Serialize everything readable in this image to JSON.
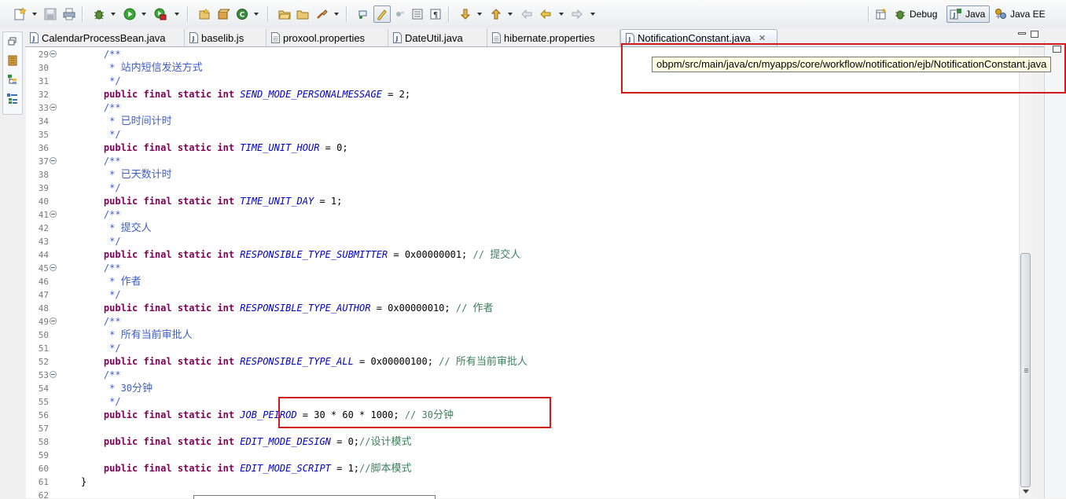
{
  "perspectives": [
    {
      "label": "Debug",
      "active": false
    },
    {
      "label": "Java",
      "active": true
    },
    {
      "label": "Java EE",
      "active": false
    }
  ],
  "tabs": [
    {
      "label": "CalendarProcessBean.java",
      "active": false
    },
    {
      "label": "baselib.js",
      "active": false
    },
    {
      "label": "proxool.properties",
      "active": false
    },
    {
      "label": "DateUtil.java",
      "active": false
    },
    {
      "label": "hibernate.properties",
      "active": false
    },
    {
      "label": "NotificationConstant.java",
      "active": true,
      "close": "✕"
    }
  ],
  "tooltip": "obpm/src/main/java/cn/myapps/core/workflow/notification/ejb/NotificationConstant.java",
  "code": {
    "lines": [
      {
        "num": "29",
        "fold": true,
        "parts": [
          [
            "cmt",
            "    /**"
          ]
        ]
      },
      {
        "num": "30",
        "fold": false,
        "parts": [
          [
            "cmt",
            "     * "
          ],
          [
            "cmtzh",
            "站内短信发送方式"
          ]
        ]
      },
      {
        "num": "31",
        "fold": false,
        "parts": [
          [
            "cmt",
            "     */"
          ]
        ]
      },
      {
        "num": "32",
        "fold": false,
        "parts": [
          [
            "kw",
            "    public final static int "
          ],
          [
            "const",
            "SEND_MODE_PERSONALMESSAGE"
          ],
          [
            "txt",
            " = 2;"
          ]
        ]
      },
      {
        "num": "33",
        "fold": true,
        "parts": [
          [
            "cmt",
            "    /**"
          ]
        ]
      },
      {
        "num": "34",
        "fold": false,
        "parts": [
          [
            "cmt",
            "     * "
          ],
          [
            "cmtzh",
            "已时间计时"
          ]
        ]
      },
      {
        "num": "35",
        "fold": false,
        "parts": [
          [
            "cmt",
            "     */"
          ]
        ]
      },
      {
        "num": "36",
        "fold": false,
        "parts": [
          [
            "kw",
            "    public final static int "
          ],
          [
            "const",
            "TIME_UNIT_HOUR"
          ],
          [
            "txt",
            " = 0;"
          ]
        ]
      },
      {
        "num": "37",
        "fold": true,
        "parts": [
          [
            "cmt",
            "    /**"
          ]
        ]
      },
      {
        "num": "38",
        "fold": false,
        "parts": [
          [
            "cmt",
            "     * "
          ],
          [
            "cmtzh",
            "已天数计时"
          ]
        ]
      },
      {
        "num": "39",
        "fold": false,
        "parts": [
          [
            "cmt",
            "     */"
          ]
        ]
      },
      {
        "num": "40",
        "fold": false,
        "parts": [
          [
            "kw",
            "    public final static int "
          ],
          [
            "const",
            "TIME_UNIT_DAY"
          ],
          [
            "txt",
            " = 1;"
          ]
        ]
      },
      {
        "num": "41",
        "fold": true,
        "parts": [
          [
            "cmt",
            "    /**"
          ]
        ]
      },
      {
        "num": "42",
        "fold": false,
        "parts": [
          [
            "cmt",
            "     * "
          ],
          [
            "cmtzh",
            "提交人"
          ]
        ]
      },
      {
        "num": "43",
        "fold": false,
        "parts": [
          [
            "cmt",
            "     */"
          ]
        ]
      },
      {
        "num": "44",
        "fold": false,
        "parts": [
          [
            "kw",
            "    public final static int "
          ],
          [
            "const",
            "RESPONSIBLE_TYPE_SUBMITTER"
          ],
          [
            "txt",
            " = 0x00000001; "
          ],
          [
            "lcmt",
            "// "
          ],
          [
            "lcmtzh",
            "提交人"
          ]
        ]
      },
      {
        "num": "45",
        "fold": true,
        "parts": [
          [
            "cmt",
            "    /**"
          ]
        ]
      },
      {
        "num": "46",
        "fold": false,
        "parts": [
          [
            "cmt",
            "     * "
          ],
          [
            "cmtzh",
            "作者"
          ]
        ]
      },
      {
        "num": "47",
        "fold": false,
        "parts": [
          [
            "cmt",
            "     */"
          ]
        ]
      },
      {
        "num": "48",
        "fold": false,
        "parts": [
          [
            "kw",
            "    public final static int "
          ],
          [
            "const",
            "RESPONSIBLE_TYPE_AUTHOR"
          ],
          [
            "txt",
            " = 0x00000010; "
          ],
          [
            "lcmt",
            "// "
          ],
          [
            "lcmtzh",
            "作者"
          ]
        ]
      },
      {
        "num": "49",
        "fold": true,
        "parts": [
          [
            "cmt",
            "    /**"
          ]
        ]
      },
      {
        "num": "50",
        "fold": false,
        "parts": [
          [
            "cmt",
            "     * "
          ],
          [
            "cmtzh",
            "所有当前审批人"
          ]
        ]
      },
      {
        "num": "51",
        "fold": false,
        "parts": [
          [
            "cmt",
            "     */"
          ]
        ]
      },
      {
        "num": "52",
        "fold": false,
        "parts": [
          [
            "kw",
            "    public final static int "
          ],
          [
            "const",
            "RESPONSIBLE_TYPE_ALL"
          ],
          [
            "txt",
            " = 0x00000100; "
          ],
          [
            "lcmt",
            "// "
          ],
          [
            "lcmtzh",
            "所有当前审批人"
          ]
        ]
      },
      {
        "num": "53",
        "fold": true,
        "parts": [
          [
            "cmt",
            "    /**"
          ]
        ]
      },
      {
        "num": "54",
        "fold": false,
        "parts": [
          [
            "cmt",
            "     * 30"
          ],
          [
            "cmtzh",
            "分钟"
          ]
        ]
      },
      {
        "num": "55",
        "fold": false,
        "parts": [
          [
            "cmt",
            "     */"
          ]
        ]
      },
      {
        "num": "56",
        "fold": false,
        "parts": [
          [
            "kw",
            "    public final static int "
          ],
          [
            "const",
            "JOB_PEIROD"
          ],
          [
            "txt",
            " = 30 * 60 * 1000; "
          ],
          [
            "lcmt",
            "// 30"
          ],
          [
            "lcmtzh",
            "分钟"
          ]
        ]
      },
      {
        "num": "57",
        "fold": false,
        "parts": []
      },
      {
        "num": "58",
        "fold": false,
        "parts": [
          [
            "kw",
            "    public final static int "
          ],
          [
            "const",
            "EDIT_MODE_DESIGN"
          ],
          [
            "txt",
            " = 0;"
          ],
          [
            "lcmt",
            "//"
          ],
          [
            "lcmtzh",
            "设计模式"
          ]
        ]
      },
      {
        "num": "59",
        "fold": false,
        "parts": []
      },
      {
        "num": "60",
        "fold": false,
        "parts": [
          [
            "kw",
            "    public final static int "
          ],
          [
            "const",
            "EDIT_MODE_SCRIPT"
          ],
          [
            "txt",
            " = 1;"
          ],
          [
            "lcmt",
            "//"
          ],
          [
            "lcmtzh",
            "脚本模式"
          ]
        ]
      },
      {
        "num": "61",
        "fold": false,
        "parts": [
          [
            "txt",
            "}"
          ]
        ]
      },
      {
        "num": "62",
        "fold": false,
        "parts": []
      }
    ]
  },
  "colors": {
    "keyword": "#7f0055",
    "javadoc": "#3f5fbf",
    "line_comment": "#3f7f5f",
    "constant": "#0000c0",
    "highlight": "#d21a1a",
    "tooltip_bg": "#ffffe1"
  },
  "icons": {
    "toolbar": [
      "new-wizard-icon",
      "save-icon",
      "print-icon",
      "debug-icon",
      "run-icon",
      "external-tools-icon",
      "new-java-project-icon",
      "new-package-icon",
      "new-class-icon",
      "open-type-icon",
      "open-folder-icon",
      "search-icon",
      "toggle-breadcrumb-icon",
      "mark-occurrences-icon",
      "block-selection-icon",
      "show-whitespace-icon",
      "paragraph-icon",
      "next-annotation-icon",
      "previous-annotation-icon",
      "last-edit-location-icon",
      "back-icon",
      "forward-icon"
    ]
  }
}
